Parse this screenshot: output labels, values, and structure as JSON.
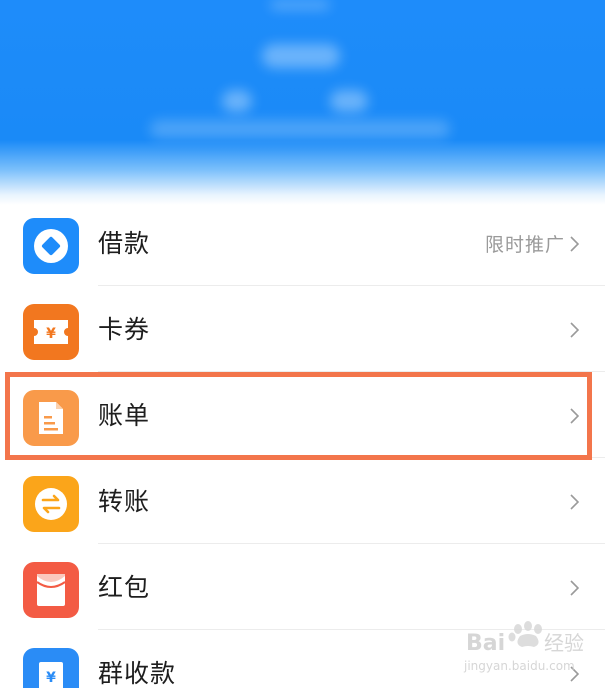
{
  "colors": {
    "header_blue": "#1e8cfa",
    "highlight": "#f3754b",
    "text": "#1e1e1e",
    "subtle": "#9a9a9a"
  },
  "menu": {
    "items": [
      {
        "label": "借款",
        "promo": "限时推广",
        "icon": "loan-icon",
        "icon_color": "#1e8cfa"
      },
      {
        "label": "卡券",
        "promo": "",
        "icon": "coupon-icon",
        "icon_color": "#f2771f"
      },
      {
        "label": "账单",
        "promo": "",
        "icon": "bill-icon",
        "icon_color": "#f99a4a",
        "highlighted": true
      },
      {
        "label": "转账",
        "promo": "",
        "icon": "transfer-icon",
        "icon_color": "#fba51a"
      },
      {
        "label": "红包",
        "promo": "",
        "icon": "red-packet-icon",
        "icon_color": "#f35b44"
      },
      {
        "label": "群收款",
        "promo": "",
        "icon": "group-collect-icon",
        "icon_color": "#2a8cf6"
      }
    ]
  },
  "watermark": {
    "logo_text": "Bai",
    "logo_suffix": "经验",
    "url": "jingyan.baidu.com"
  }
}
